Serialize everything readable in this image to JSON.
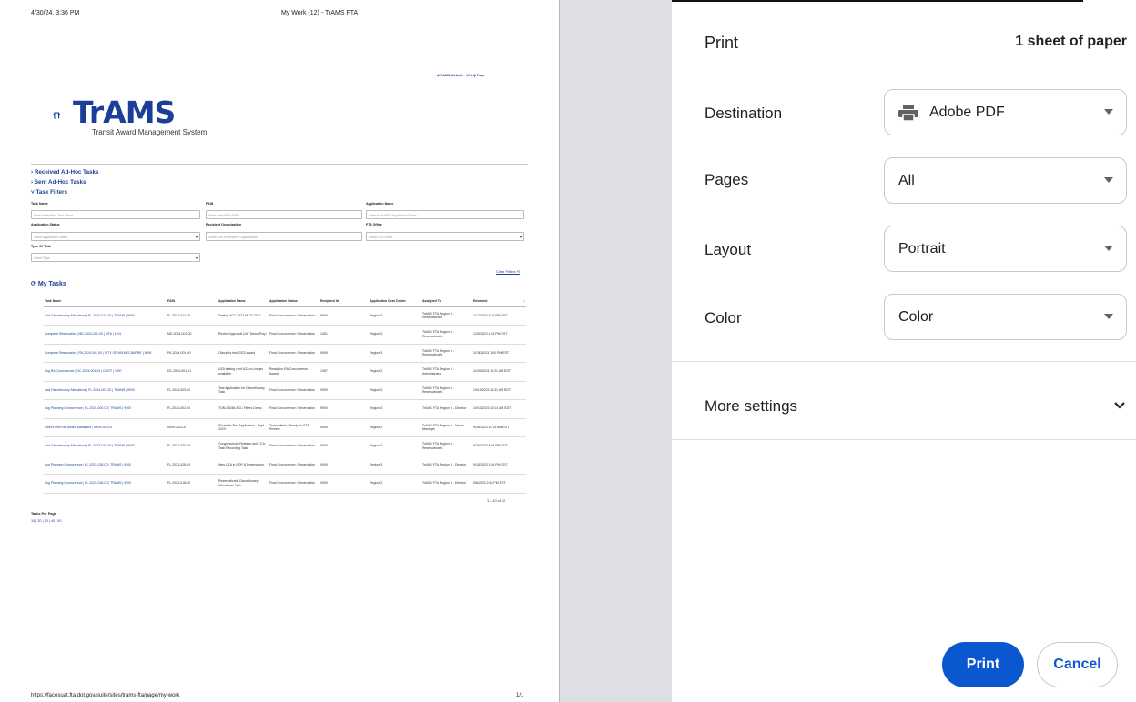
{
  "sheet": {
    "header_date": "4/30/24, 3:36 PM",
    "header_title": "My Work (12) - TrAMS FTA",
    "footer_url": "https://facesuat.fta.dot.gov/suite/sites/trams-fta/page/my-work",
    "footer_page": "1/1",
    "top_links": [
      "TrAMS Website",
      "Help Page"
    ],
    "logo_text": "TrAMS",
    "logo_sub": "Transit Award Management System",
    "received": "Received Ad-Hoc Tasks",
    "sent": "Sent Ad-Hoc Tasks",
    "filters": "Task Filters",
    "fields": {
      "task_name": {
        "label": "Task Name",
        "placeholder": "Enter Partial/Full Task Name"
      },
      "fain": {
        "label": "FAIN",
        "placeholder": "Enter Partial/Full FAIN"
      },
      "app_name": {
        "label": "Application Name",
        "placeholder": "Enter Partial/Full Application Name"
      },
      "app_status": {
        "label": "Application Status",
        "placeholder": "Select Application Status"
      },
      "recipient_org": {
        "label": "Recipient Organization",
        "placeholder": "Search for a Recipient Organization"
      },
      "fta_office": {
        "label": "FTA Office",
        "placeholder": "Select FTA Office"
      },
      "type": {
        "label": "Type Of Task",
        "placeholder": "Select Type"
      }
    },
    "clear_filters": "Clear Filters",
    "my_tasks": "My Tasks",
    "columns": [
      "Task Name",
      "FAIN",
      "Application Name",
      "Application Status",
      "Recipient Id",
      "Application Cost Center",
      "Assigned To",
      "Received"
    ],
    "rows": [
      [
        "Add Discretionary Allocations | FL-2024-014-00 | TRAMS | 9900",
        "FL-2024-014-00",
        "Testing ACC 2022.68.22.CD-1",
        "Final Concurrence / Reservation",
        "9900",
        "Region 3",
        "TrAMS FTA Region 3 - Reservationist",
        "1/17/2024 3:33 PM EST"
      ],
      [
        "Complete Reservation | MD-2024-001-00 | MTA | 1401",
        "MD-2024-001-00",
        "Review Approval UAT Demo Prep",
        "Final Concurrence / Reservation",
        "1401",
        "Region 3",
        "TrAMS FTA Region 3 - Reservationist",
        "12/5/2023 1:53 PM EST"
      ],
      [
        "Complete Reservation | PA-2024-001-00 | CITY OF WILKES BARRE | 5909",
        "PA-2024-001-00",
        "Claudia's test 2023 award",
        "Final Concurrence / Reservation",
        "5909",
        "Region 3",
        "TrAMS FTA Region 3 - Reservationist",
        "11/30/2023 1:00 PM EST"
      ],
      [
        "Log RA Concurrence | DC-2024-001-01 | DDOT | 1397",
        "DC-2024-001-01",
        "UZA testing conf UZA no longer available",
        "Ready for RA Concurrence / Award",
        "1397",
        "Region 3",
        "TrAMS FTA Region 3 - Administrator",
        "11/29/2023 10:21 AM EST"
      ],
      [
        "Add Discretionary Allocations | FL-2024-003-00 | TRAMS | 9900",
        "FL-2024-003-00",
        "Test Application for Discretionary Task",
        "Final Concurrence / Reservation",
        "9900",
        "Region 3",
        "TrAMS FTA Region 3 - Reservationist",
        "10/19/2023 11:31 AM EDT"
      ],
      [
        "Log Planning Concurrence | FL-2024-002-00 | TRAMS | 9900",
        "FL-2024-002-00",
        "TOM-15284 ACC Filters Demo",
        "Final Concurrence / Reservation",
        "9900",
        "Region 3",
        "TrAMS FTA Region 3 - Director",
        "10/10/2023 10:01 AM EDT"
      ],
      [
        "Select Pre/Post Award Managers | 5909-2023-5",
        "5909-2023-5",
        "Elizabeth Test Application - Sept 2023",
        "Transmitted / Ready for FTA Review",
        "5909",
        "Region 3",
        "TrAMS FTA Region 3 - Intake Manager",
        "9/28/2023 10:14 AM EDT"
      ],
      [
        "Add Discretionary Allocations | FL-2023-020-00 | TRAMS | 9900",
        "FL-2023-020-00",
        "Congressional Release and TCA Task Recording Task",
        "Final Concurrence / Reservation",
        "9900",
        "Region 3",
        "TrAMS FTA Region 3 - Reservationist",
        "9/25/2023 4:04 PM EDT"
      ],
      [
        "Log Planning Concurrence | FL-2023-028-00 | TRAMS | 9900",
        "FL-2023-028-00",
        "New UZA in POP & Reservation",
        "Final Concurrence / Reservation",
        "9900",
        "Region 3",
        "TrAMS FTA Region 3 - Director",
        "9/18/2023 1:55 PM EDT"
      ],
      [
        "Log Planning Concurrence | FL-2023-018-00 | TRAMS | 9900",
        "FL-2023-018-00",
        "Reservationist Discretionary Allocations Task",
        "Final Concurrence / Reservation",
        "9900",
        "Region 3",
        "TrAMS FTA Region 3 - Director",
        "9/8/2023 2:48 PM EDT"
      ]
    ],
    "pager": "1 – 10 of 12",
    "tasks_per_page": "Tasks Per Page",
    "tasks_per_page_values": "10 | 20 | 30 | 40 | 50"
  },
  "panel": {
    "title": "Print",
    "sheets": "1 sheet of paper",
    "destination_label": "Destination",
    "destination_value": "Adobe PDF",
    "pages_label": "Pages",
    "pages_value": "All",
    "layout_label": "Layout",
    "layout_value": "Portrait",
    "color_label": "Color",
    "color_value": "Color",
    "more_settings": "More settings",
    "print_button": "Print",
    "cancel_button": "Cancel"
  },
  "colors": {
    "accent": "#0b57d0",
    "trams_blue": "#1b3f99",
    "gutter": "#dedfe3"
  }
}
